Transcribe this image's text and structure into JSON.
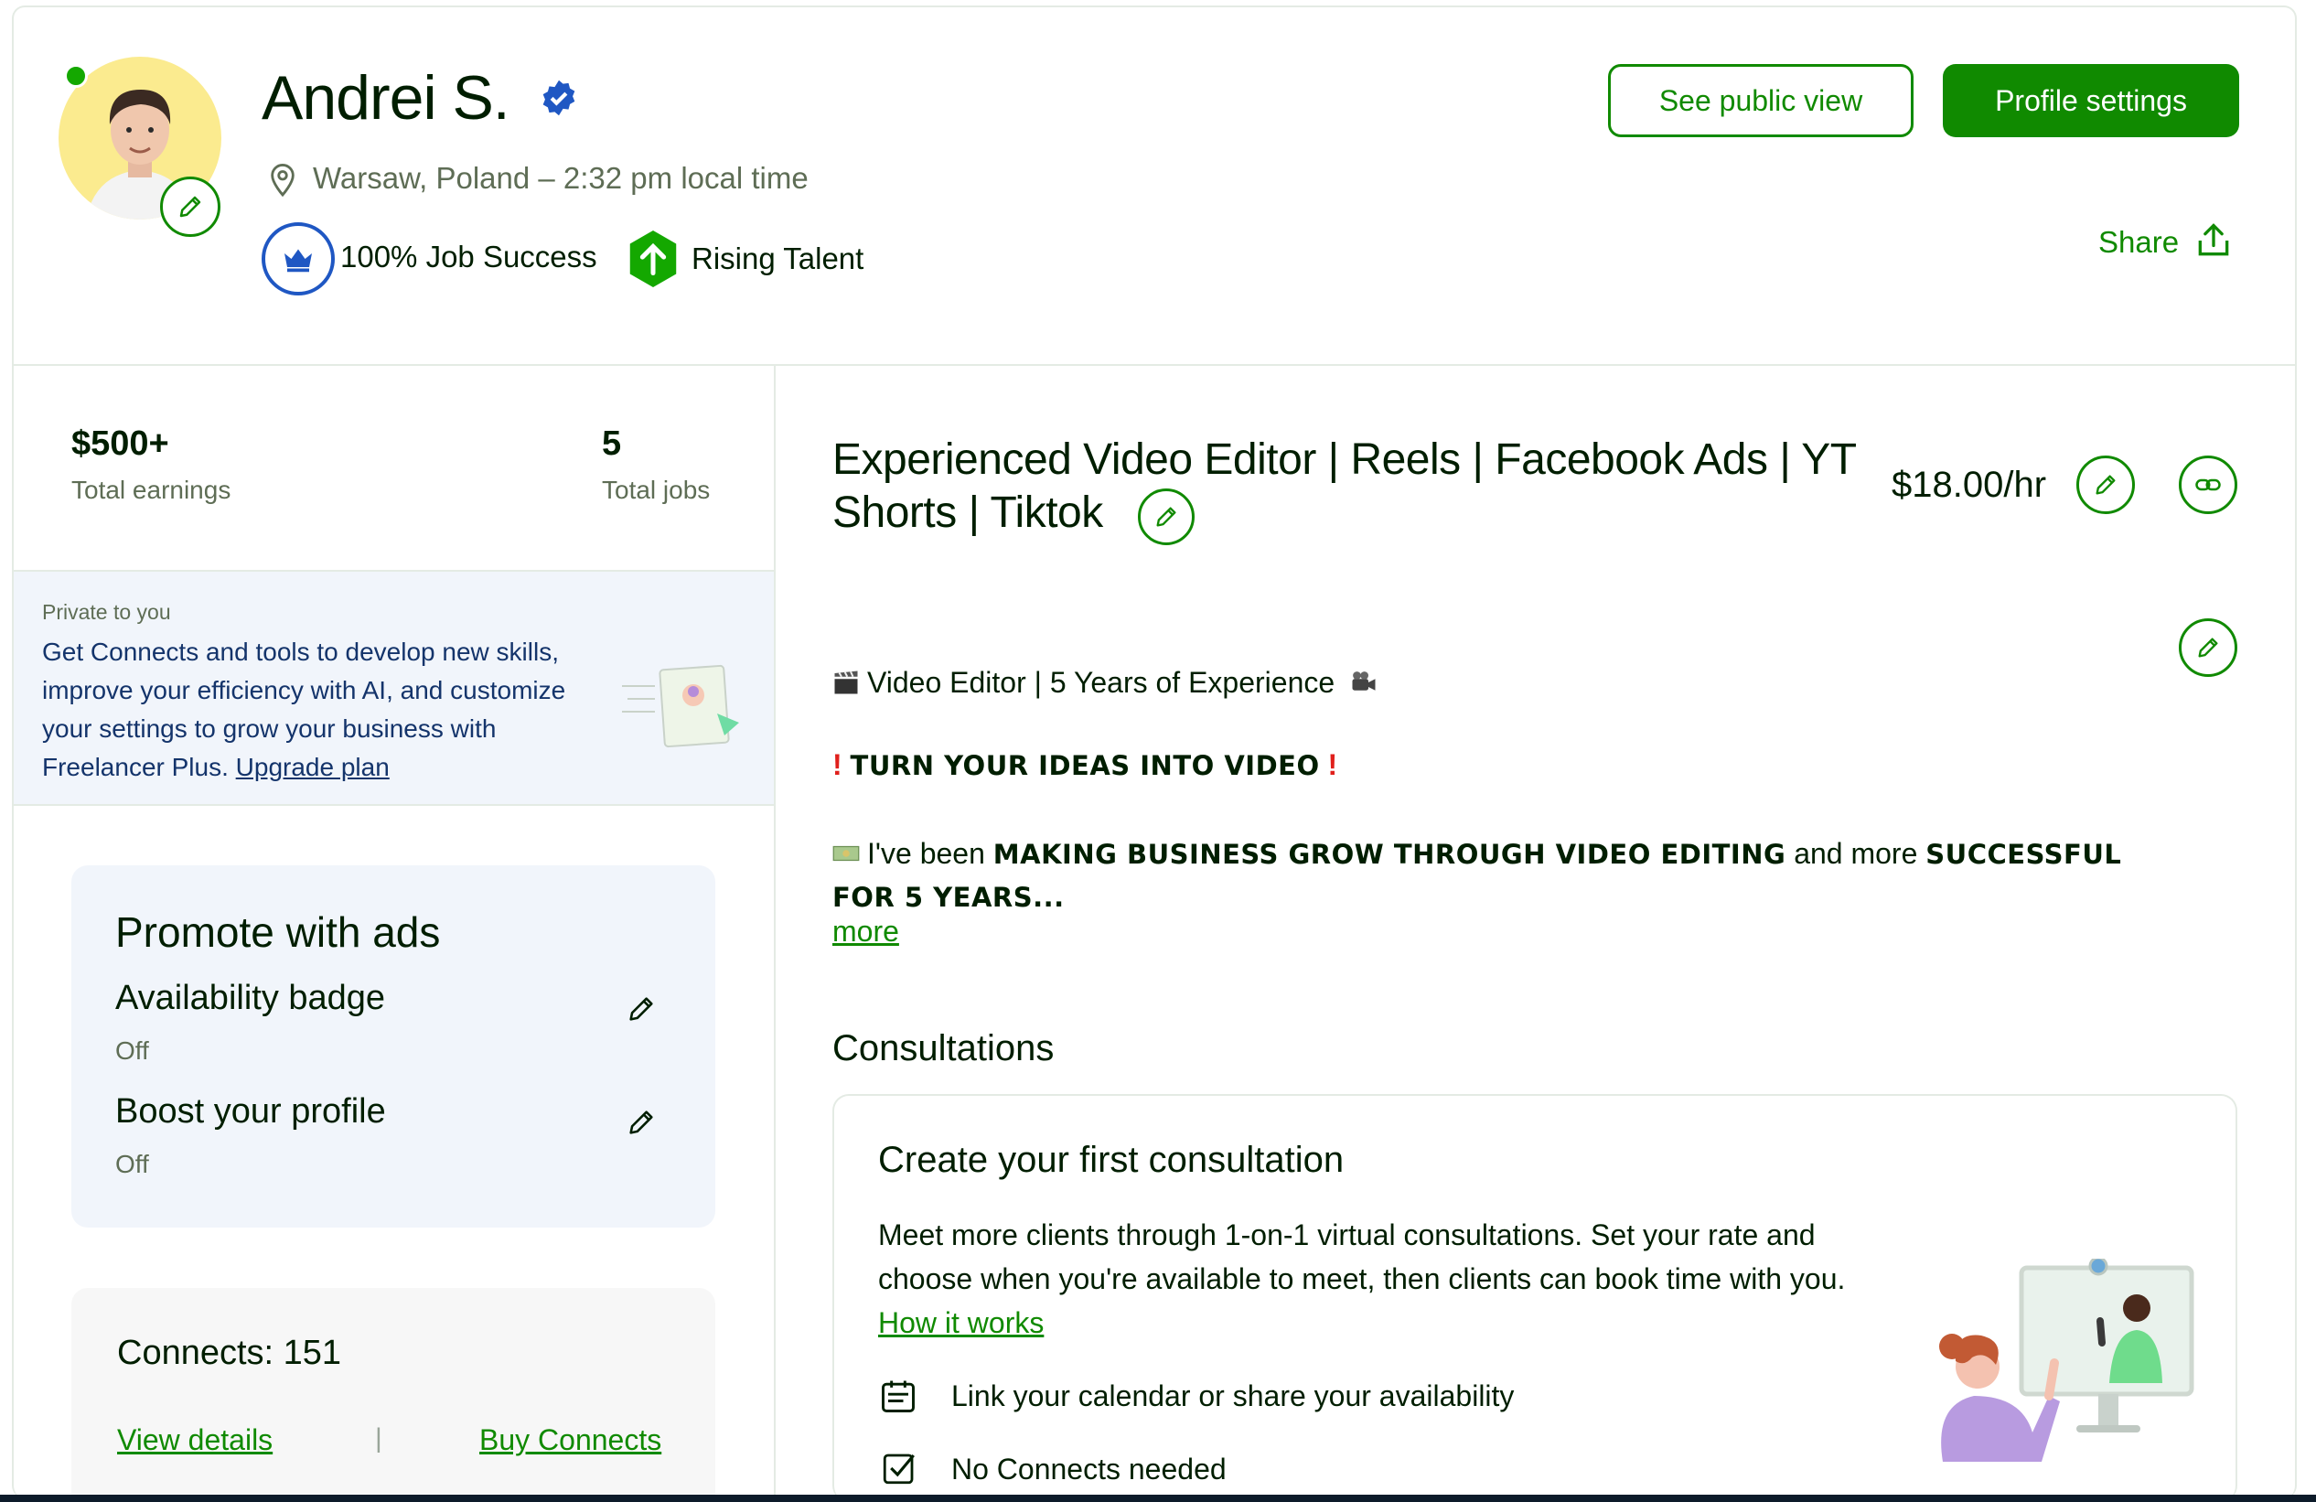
{
  "header": {
    "name": "Andrei S.",
    "location": "Warsaw, Poland – 2:32 pm local time",
    "job_success": "100% Job Success",
    "rising_talent": "Rising Talent",
    "see_public_view": "See public view",
    "profile_settings": "Profile settings",
    "share": "Share"
  },
  "stats": {
    "earnings_value": "$500+",
    "earnings_label": "Total earnings",
    "jobs_value": "5",
    "jobs_label": "Total jobs"
  },
  "promo": {
    "private_label": "Private to you",
    "text": "Get Connects and tools to develop new skills, improve your efficiency with AI, and customize your settings to grow your business with Freelancer Plus.",
    "upgrade_link": "Upgrade plan"
  },
  "ads": {
    "title": "Promote with ads",
    "availability_title": "Availability badge",
    "availability_value": "Off",
    "boost_title": "Boost your profile",
    "boost_value": "Off"
  },
  "connects": {
    "title": "Connects: 151",
    "view_details": "View details",
    "separator": "|",
    "buy": "Buy Connects"
  },
  "profile": {
    "title": "Experienced Video Editor | Reels | Facebook Ads | YT Shorts | Tiktok",
    "rate": "$18.00/hr",
    "desc_line1": "Video Editor | 5 Years of Experience",
    "desc_line2": "TURN YOUR IDEAS INTO VIDEO",
    "desc_line3_a": "I've been",
    "desc_line3_b": "MAKING BUSINESS GROW THROUGH VIDEO EDITING",
    "desc_line3_c": "and more",
    "desc_line3_d": "SUCCESSFUL FOR 5 YEARS...",
    "more": "more"
  },
  "consultations": {
    "heading": "Consultations",
    "card_title": "Create your first consultation",
    "card_text": "Meet more clients through 1-on-1 virtual consultations. Set your rate and choose when you're available to meet, then clients can book time with you.",
    "how_it_works": "How it works",
    "feature1": "Link your calendar or share your availability",
    "feature2": "No Connects needed"
  },
  "colors": {
    "brand_green": "#108a00",
    "badge_blue": "#1f57c3",
    "promo_bg": "#f1f5fb"
  }
}
